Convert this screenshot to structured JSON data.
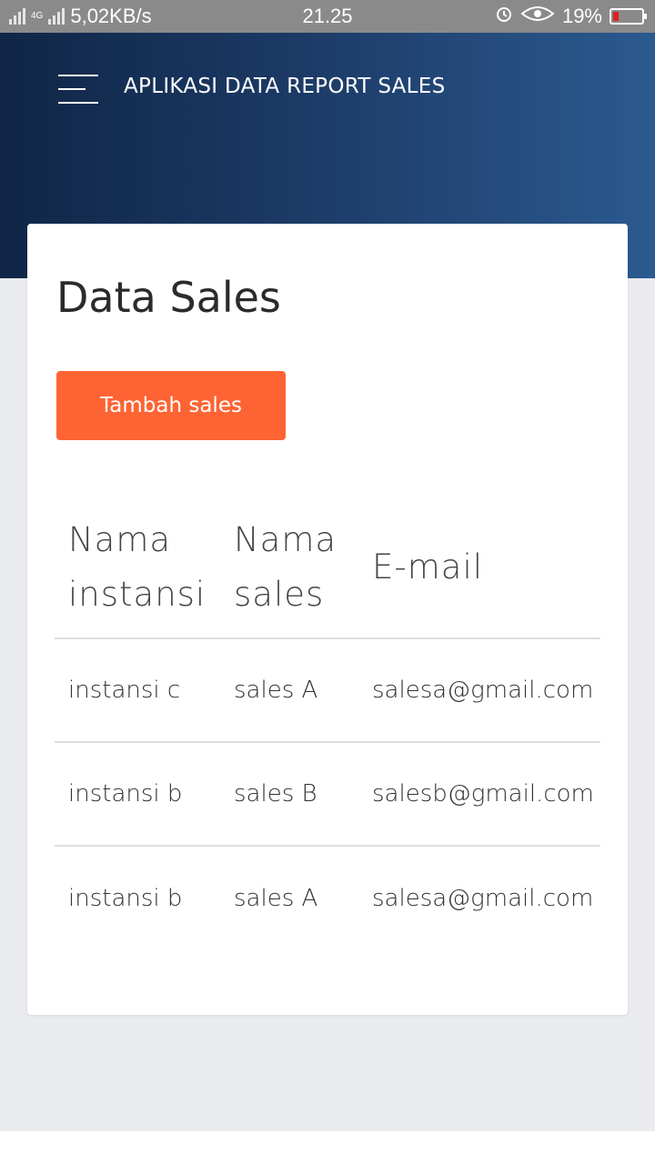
{
  "status_bar": {
    "net_speed": "5,02KB/s",
    "net_tag": "4G",
    "time": "21.25",
    "battery": "19%",
    "battery_level": 0.19,
    "battery_color": "#e02020"
  },
  "header": {
    "menu_icon": "hamburger-menu-icon",
    "title": "APLIKASI DATA REPORT SALES"
  },
  "card": {
    "title": "Data Sales",
    "add_button_label": "Tambah sales",
    "accent_color": "#fe6433"
  },
  "table": {
    "headers": [
      "Nama instansi",
      "Nama sales",
      "E-mail"
    ],
    "rows": [
      [
        "instansi c",
        "sales A",
        "salesa@gmail.com"
      ],
      [
        "instansi b",
        "sales B",
        "salesb@gmail.com"
      ],
      [
        "instansi b",
        "sales A",
        "salesa@gmail.com"
      ]
    ]
  }
}
